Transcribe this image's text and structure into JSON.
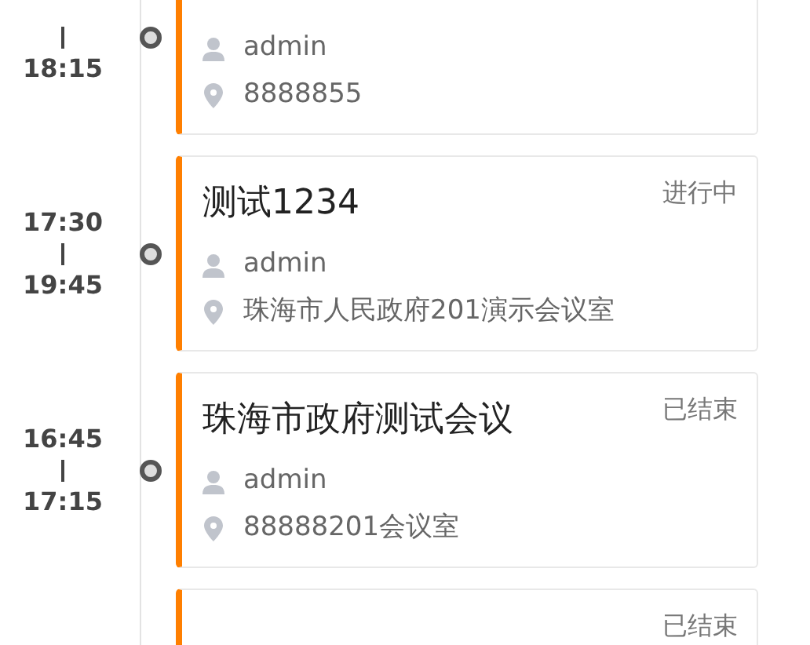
{
  "meetings": [
    {
      "end_time": "18:15",
      "organizer": "admin",
      "location": "8888855"
    },
    {
      "start_time": "17:30",
      "end_time": "19:45",
      "title": "测试1234",
      "status": "进行中",
      "organizer": "admin",
      "location": "珠海市人民政府201演示会议室"
    },
    {
      "start_time": "16:45",
      "end_time": "17:15",
      "title": "珠海市政府测试会议",
      "status": "已结束",
      "organizer": "admin",
      "location": "88888201会议室"
    },
    {
      "status": "已结束"
    }
  ]
}
